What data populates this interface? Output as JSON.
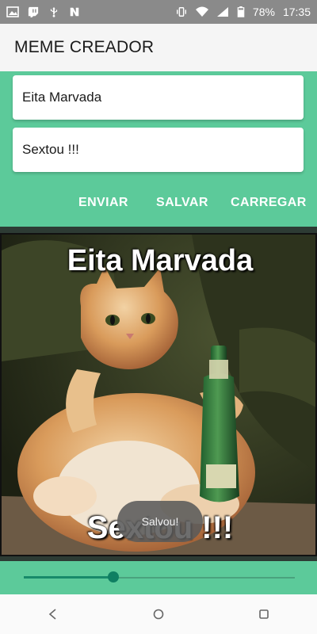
{
  "status_bar": {
    "battery": "78%",
    "time": "17:35",
    "icons": [
      "image-icon",
      "twitch-icon",
      "usb-icon",
      "n-app-icon",
      "vibrate-icon",
      "wifi-icon",
      "signal-icon",
      "battery-icon"
    ]
  },
  "app_bar": {
    "title": "MEME CREADOR"
  },
  "form": {
    "top_text": "Eita Marvada",
    "bottom_text": "Sextou !!!"
  },
  "actions": {
    "send": "ENVIAR",
    "save": "SALVAR",
    "load": "CARREGAR"
  },
  "meme": {
    "top_caption": "Eita Marvada",
    "bottom_caption": "Sextou !!!"
  },
  "toast": {
    "message": "Salvou!"
  },
  "slider": {
    "value": 0.33
  },
  "colors": {
    "accent": "#5cca9a",
    "thumb": "#0f7f62",
    "status": "#8a8a8a"
  },
  "nav": {
    "icons": [
      "back-icon",
      "home-icon",
      "recents-icon"
    ]
  }
}
